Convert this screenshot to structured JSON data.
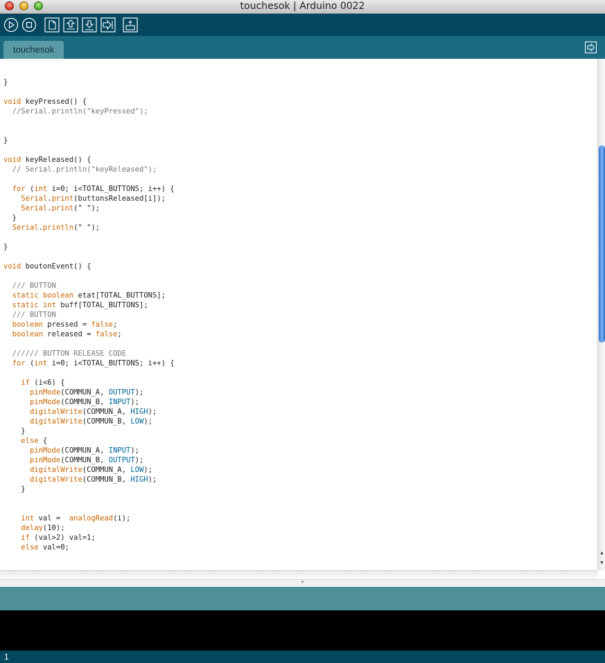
{
  "window": {
    "title": "touchesok | Arduino 0022"
  },
  "toolbar": {
    "buttons": [
      "verify",
      "stop",
      "new",
      "open",
      "save",
      "upload",
      "serial-monitor"
    ]
  },
  "tabs": [
    {
      "label": "touchesok"
    }
  ],
  "editor": {
    "lines": [
      "}",
      "",
      "void keyPressed() {",
      "  //Serial.println(\"keyPressed\");",
      "",
      "",
      "}",
      "",
      "void keyReleased() {",
      "  // Serial.println(\"keyReleased\");",
      "",
      "  for (int i=0; i<TOTAL_BUTTONS; i++) {",
      "    Serial.print(buttonsReleased[i]);",
      "    Serial.print(\" \");",
      "  }",
      "  Serial.println(\" \");",
      "",
      "}",
      "",
      "void boutonEvent() {",
      "",
      "  /// BUTTON",
      "  static boolean etat[TOTAL_BUTTONS];",
      "  static int buff[TOTAL_BUTTONS];",
      "  /// BUTTON",
      "  boolean pressed = false;",
      "  boolean released = false;",
      "",
      "  ////// BUTTON RELEASE CODE",
      "  for (int i=0; i<TOTAL_BUTTONS; i++) {",
      "",
      "    if (i<6) {",
      "      pinMode(COMMUN_A, OUTPUT);",
      "      pinMode(COMMUN_B, INPUT);",
      "      digitalWrite(COMMUN_A, HIGH);",
      "      digitalWrite(COMMUN_B, LOW);",
      "    }",
      "    else {",
      "      pinMode(COMMUN_A, INPUT);",
      "      pinMode(COMMUN_B, OUTPUT);",
      "      digitalWrite(COMMUN_A, LOW);",
      "      digitalWrite(COMMUN_B, HIGH);",
      "    }",
      "",
      "",
      "    int val =  analogRead(i);",
      "    delay(10);",
      "    if (val>2) val=1;",
      "    else val=0;"
    ],
    "colors": {
      "keyword": "#cc6600",
      "constant": "#006699",
      "comment": "#777777"
    }
  },
  "resizer": {
    "glyph": "⌃"
  },
  "status": {
    "message": ""
  },
  "console": {
    "text": ""
  },
  "footer": {
    "line_number": "1"
  }
}
